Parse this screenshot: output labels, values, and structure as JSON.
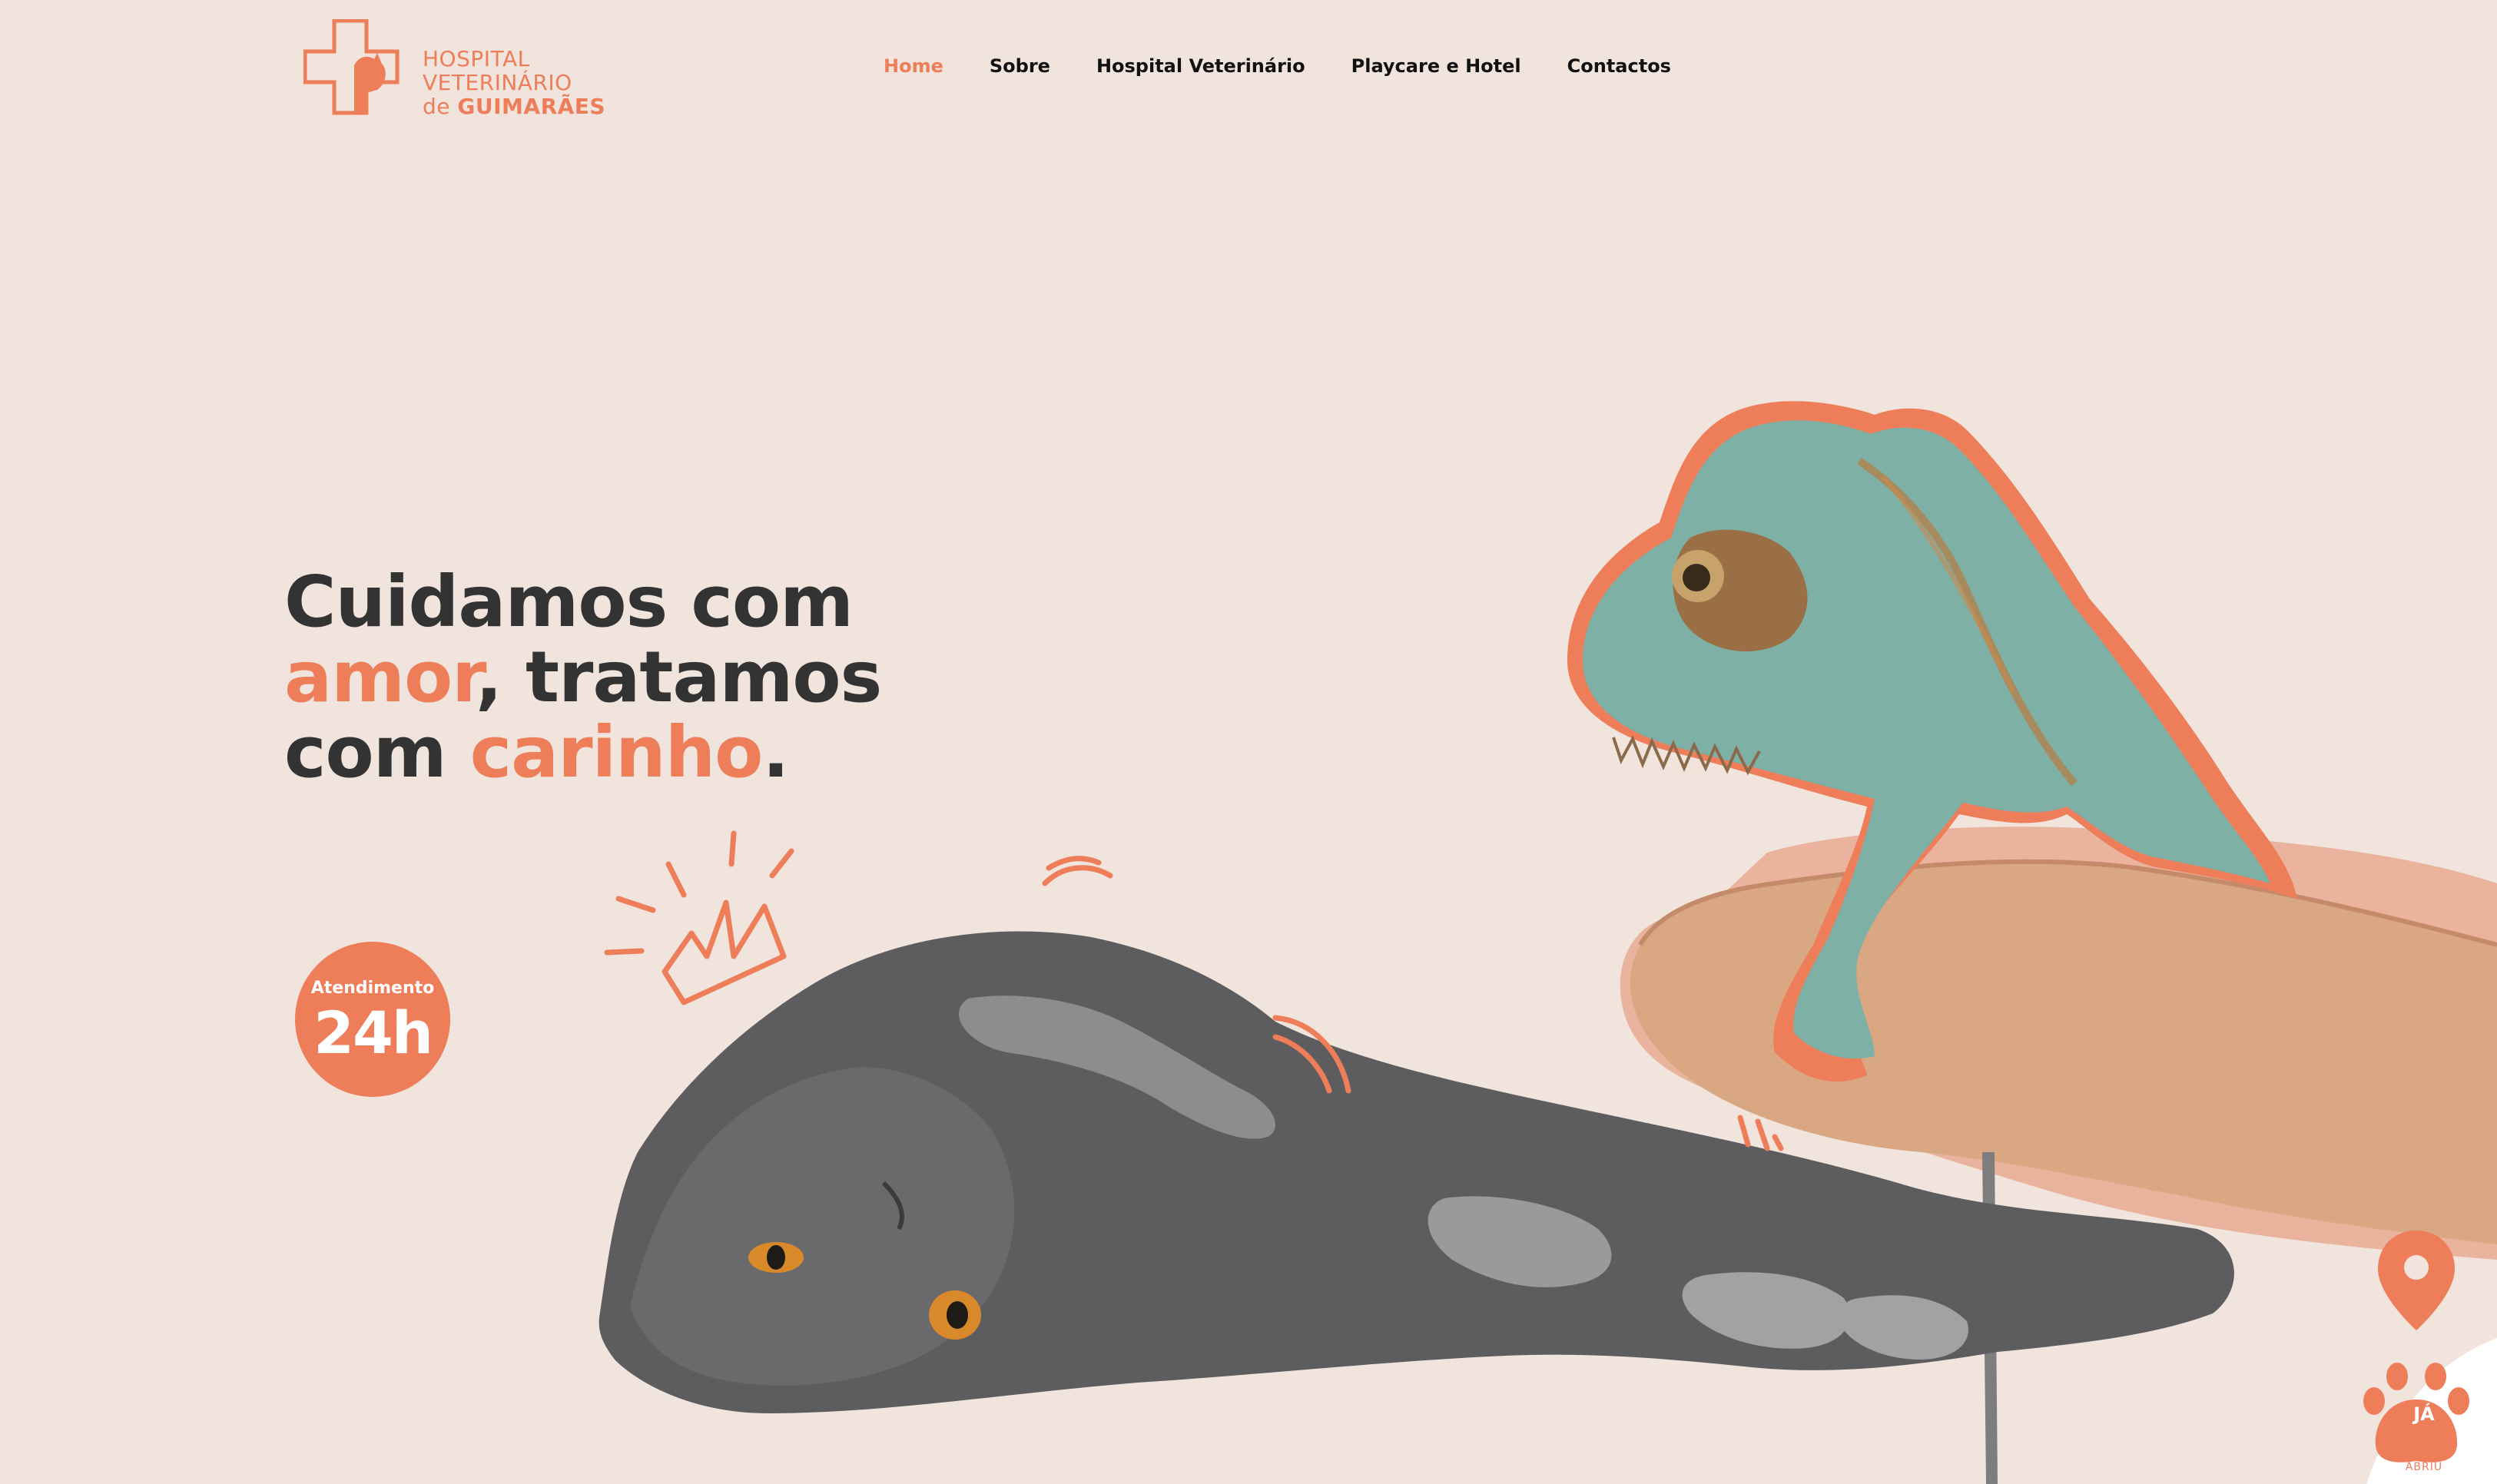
{
  "brand": {
    "line1": "HOSPITAL",
    "line2": "VETERINÁRIO",
    "line3_prefix": "de",
    "line3_bold": "GUIMARÃES",
    "accent_color": "#ee7d5a"
  },
  "nav": {
    "items": [
      {
        "label": "Home",
        "active": true
      },
      {
        "label": "Sobre"
      },
      {
        "label": "Hospital Veterinário"
      },
      {
        "label": "Playcare e Hotel"
      },
      {
        "label": "Contactos"
      }
    ]
  },
  "hero": {
    "heading": {
      "line1": "Cuidamos com",
      "line2_accent": "amor",
      "line2_rest": ", tratamos",
      "line3_start": "com ",
      "line3_accent": "carinho",
      "line3_end": "."
    },
    "badge": {
      "label": "Atendimento",
      "value": "24h"
    },
    "images": {
      "cat": "grey-cat-lying-photo",
      "chameleon": "chameleon-on-hand-photo"
    }
  },
  "widget": {
    "label": "JÁ",
    "sublabel": "ABRIU",
    "icons": [
      "location-pin-icon",
      "paw-icon"
    ]
  },
  "colors": {
    "background": "#f0e4dc",
    "accent": "#ee7d5a",
    "text": "#333333"
  }
}
